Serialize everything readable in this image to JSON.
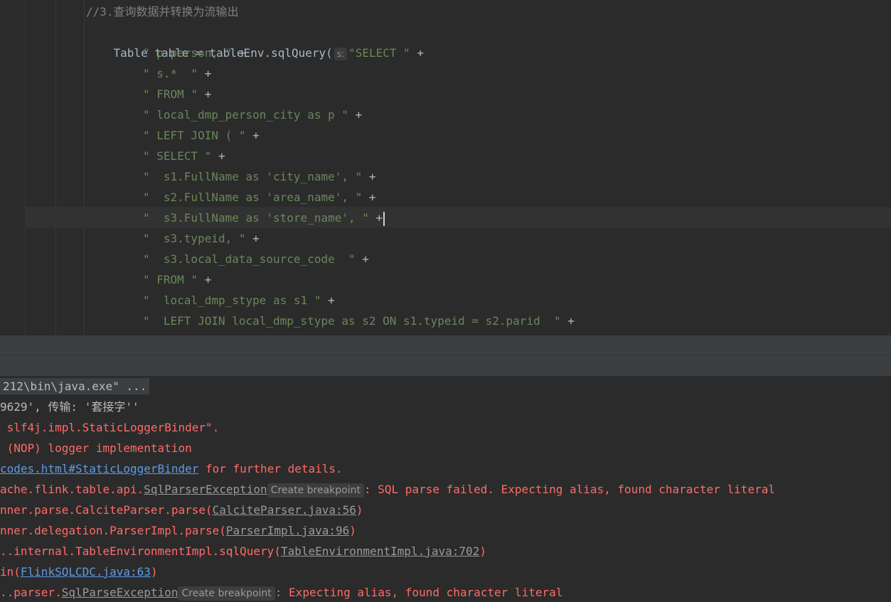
{
  "editor": {
    "comment": "//3.查询数据并转换为流输出",
    "first_line_prefix": "Table table = tableEnv.sqlQuery(",
    "param_hint": "s:",
    "first_line_string": "\"SELECT \"",
    "plus": "+",
    "lines": [
      "\" p.person, \"",
      "\" s.*  \"",
      "\" FROM \"",
      "\" local_dmp_person_city as p \"",
      "\" LEFT JOIN ( \"",
      "\" SELECT \"",
      "\"  s1.FullName as 'city_name', \"",
      "\"  s2.FullName as 'area_name', \"",
      "\"  s3.FullName as 'store_name', \"",
      "\"  s3.typeid, \"",
      "\"  s3.local_data_source_code  \"",
      "\" FROM \"",
      "\"  local_dmp_stype as s1 \"",
      "\"  LEFT JOIN local_dmp_stype as s2 ON s1.typeid = s2.parid  \""
    ]
  },
  "console": {
    "cmd": "212\\bin\\java.exe\" ...",
    "line2": "9629', 传输: '套接字''",
    "line3": " slf4j.impl.StaticLoggerBinder\".",
    "line4": " (NOP) logger implementation",
    "line5_link": "codes.html#StaticLoggerBinder",
    "line5_rest": " for further details.",
    "line6_prefix": "ache.flink.table.api.",
    "line6_exception": "SqlParserException",
    "create_breakpoint": "Create breakpoint",
    "line6_msg": ": SQL parse failed. Expecting alias, found character literal",
    "line7_prefix": "nner.parse.CalciteParser.parse(",
    "line7_link": "CalciteParser.java:56",
    "line8_prefix": "nner.delegation.ParserImpl.parse(",
    "line8_link": "ParserImpl.java:96",
    "line9_prefix": "..internal.TableEnvironmentImpl.sqlQuery(",
    "line9_link": "TableEnvironmentImpl.java:702",
    "line10_prefix": "in(",
    "line10_link": "FlinkSQLCDC.java:63",
    "line11_prefix": "..parser.",
    "line11_exception": "SqlParseException",
    "line11_msg": ": Expecting alias, found character literal",
    "close_paren": ")"
  }
}
